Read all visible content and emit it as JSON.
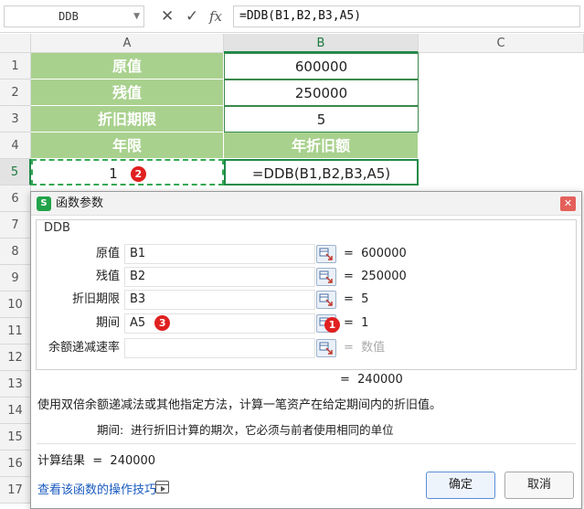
{
  "formula_bar": {
    "name_box": "DDB",
    "cancel_icon": "✕",
    "confirm_icon": "✓",
    "fx_label": "fx",
    "formula": "=DDB(B1,B2,B3,A5)"
  },
  "grid": {
    "columns": [
      "A",
      "B",
      "C"
    ],
    "rows": [
      "1",
      "2",
      "3",
      "4",
      "5",
      "6",
      "7",
      "8",
      "9",
      "10",
      "11",
      "12",
      "13",
      "14",
      "15",
      "16",
      "17"
    ],
    "cells": {
      "A1": "原值",
      "B1": "600000",
      "A2": "残值",
      "B2": "250000",
      "A3": "折旧期限",
      "B3": "5",
      "A4": "年限",
      "B4": "年折旧额",
      "A5": "1",
      "B5": "=DDB(B1,B2,B3,A5)"
    },
    "badge_a5": "2"
  },
  "dialog": {
    "title": "函数参数",
    "logo_letter": "S",
    "close_icon": "✕",
    "function_name": "DDB",
    "args": [
      {
        "label": "原值",
        "value": "B1",
        "result": "=  600000"
      },
      {
        "label": "残值",
        "value": "B2",
        "result": "=  250000"
      },
      {
        "label": "折旧期限",
        "value": "B3",
        "result": "=  5"
      },
      {
        "label": "期间",
        "value": "A5",
        "result": "=  1",
        "badge": "3",
        "side_badge": "1"
      },
      {
        "label": "余额递减速率",
        "value": "",
        "result": "=  数值"
      }
    ],
    "total": "=  240000",
    "description": "使用双倍余额递减法或其他指定方法，计算一笔资产在给定期间内的折旧值。",
    "param_description": "期间:  进行折旧计算的期次，它必须与前者使用相同的单位",
    "calc_result": "计算结果  =  240000",
    "help_link": "查看该函数的操作技巧",
    "ok_label": "确定",
    "cancel_label": "取消"
  },
  "colors": {
    "header_green_fill": "#a9d18e",
    "selection_green": "#1f8a49",
    "badge_red": "#e02020",
    "link_blue": "#1a5bbf"
  }
}
